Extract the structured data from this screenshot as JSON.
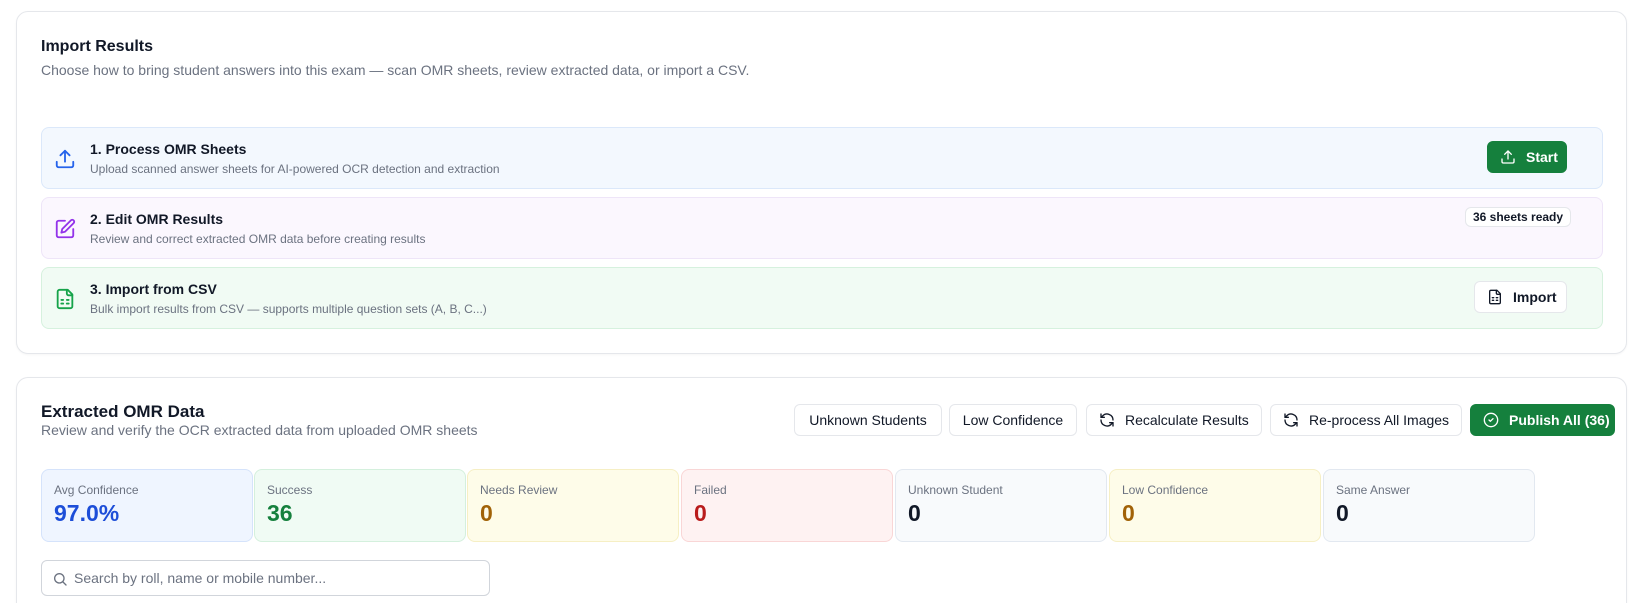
{
  "import_results": {
    "title": "Import Results",
    "subtitle": "Choose how to bring student answers into this exam — scan OMR sheets, review extracted data, or import a CSV.",
    "options": [
      {
        "title": "1. Process OMR Sheets",
        "description": "Upload scanned answer sheets for AI-powered OCR detection and extraction",
        "icon": "upload-icon",
        "action_label": "Start",
        "color": "#2563eb"
      },
      {
        "title": "2. Edit OMR Results",
        "description": "Review and correct extracted OMR data before creating results",
        "icon": "edit-icon",
        "badge": "36 sheets ready",
        "color": "#9333ea"
      },
      {
        "title": "3. Import from CSV",
        "description": "Bulk import results from CSV — supports multiple question sets (A, B, C...)",
        "icon": "spreadsheet-icon",
        "action_label": "Import",
        "color": "#16a34a"
      }
    ]
  },
  "extracted_omr": {
    "title": "Extracted OMR Data",
    "subtitle": "Review and verify the OCR extracted data from uploaded OMR sheets",
    "buttons": {
      "unknown_students": "Unknown Students",
      "low_confidence": "Low Confidence",
      "recalculate": "Recalculate Results",
      "reprocess": "Re-process All Images",
      "publish": "Publish All (36)"
    },
    "stats": [
      {
        "label": "Avg Confidence",
        "value": "97.0%",
        "tone": "blue"
      },
      {
        "label": "Success",
        "value": "36",
        "tone": "green"
      },
      {
        "label": "Needs Review",
        "value": "0",
        "tone": "yellow"
      },
      {
        "label": "Failed",
        "value": "0",
        "tone": "red"
      },
      {
        "label": "Unknown Student",
        "value": "0",
        "tone": "gray"
      },
      {
        "label": "Low Confidence",
        "value": "0",
        "tone": "yellow"
      },
      {
        "label": "Same Answer",
        "value": "0",
        "tone": "gray"
      }
    ],
    "search": {
      "placeholder": "Search by roll, name or mobile number...",
      "value": ""
    }
  },
  "colors": {
    "primary_green": "#15803d",
    "accent_blue": "#1d4ed8",
    "danger_red": "#b91c1c",
    "warning_amber": "#a16207"
  }
}
